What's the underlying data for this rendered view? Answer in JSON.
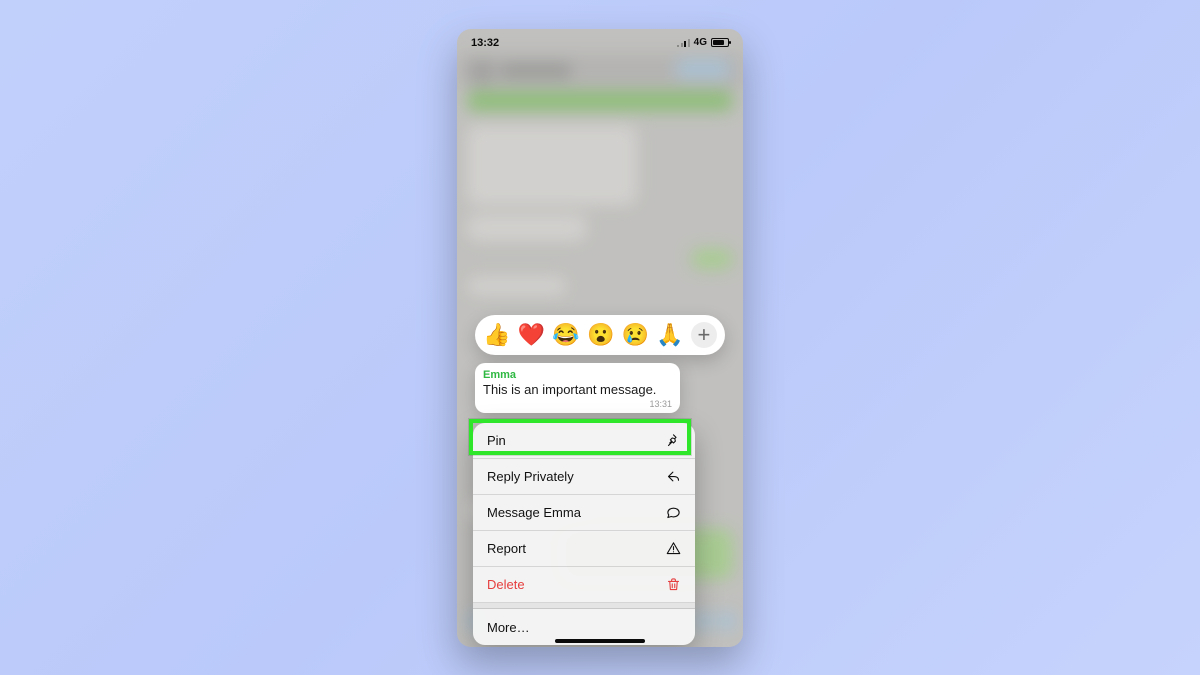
{
  "status": {
    "time": "13:32",
    "network": "4G"
  },
  "reactions": {
    "emojis": [
      "👍",
      "❤️",
      "😂",
      "😮",
      "😢",
      "🙏"
    ],
    "add_label": "+"
  },
  "message": {
    "sender": "Emma",
    "text": "This is an important message.",
    "time": "13:31"
  },
  "menu": {
    "pin": {
      "label": "Pin",
      "icon": "pin-icon"
    },
    "reply": {
      "label": "Reply Privately",
      "icon": "reply-icon"
    },
    "msg_user": {
      "label": "Message Emma",
      "icon": "chat-icon"
    },
    "report": {
      "label": "Report",
      "icon": "warning-icon"
    },
    "delete": {
      "label": "Delete",
      "icon": "trash-icon"
    },
    "more": {
      "label": "More…"
    }
  },
  "highlight": {
    "target": "menu.pin"
  }
}
